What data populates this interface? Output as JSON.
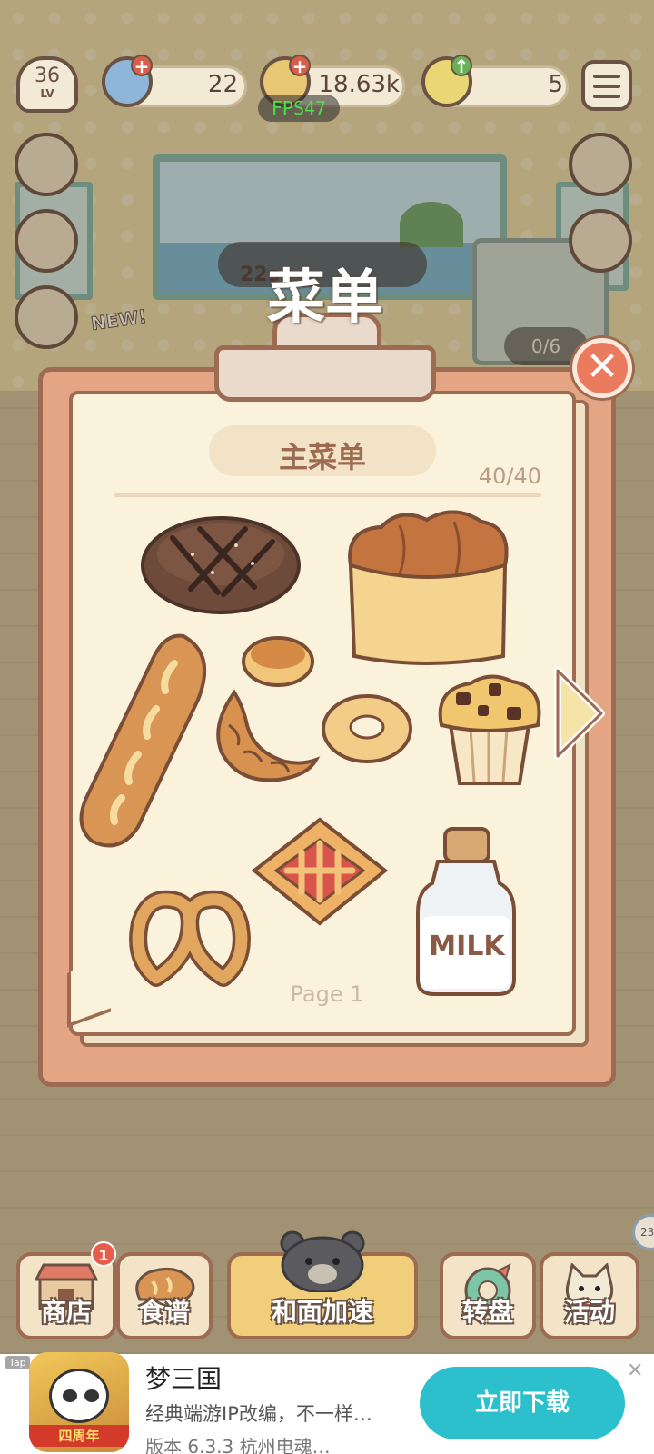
{
  "hud": {
    "level": "36",
    "level_label": "LV",
    "gems": "22",
    "coins": "18.63k",
    "stars": "5",
    "fps": "FPS47"
  },
  "scene": {
    "new_badge": "NEW!",
    "timer": "22s",
    "fridge_counter": "0/6"
  },
  "dialog": {
    "title": "菜单",
    "subtitle": "主菜单",
    "count": "40/40",
    "page": "Page 1",
    "milk_label": "MILK",
    "close_glyph": "✕",
    "items": [
      {
        "icon": "boule-bread-icon"
      },
      {
        "icon": "loaf-bread-icon"
      },
      {
        "icon": "baguette-icon"
      },
      {
        "icon": "bun-icon"
      },
      {
        "icon": "croissant-icon"
      },
      {
        "icon": "bagel-icon"
      },
      {
        "icon": "muffin-icon"
      },
      {
        "icon": "pie-pastry-icon"
      },
      {
        "icon": "pretzel-icon"
      },
      {
        "icon": "milk-bottle-icon"
      }
    ]
  },
  "nav": {
    "shop": "商店",
    "shop_badge": "1",
    "recipes": "食谱",
    "knead_speedup": "和面加速",
    "wheel": "转盘",
    "events": "活动"
  },
  "floating_coin": "23",
  "ad": {
    "tag": "Tap",
    "title": "梦三国",
    "description": "经典端游IP改编，不一样…",
    "version": "版本 6.3.3  杭州电魂…",
    "cta": "立即下载",
    "close_glyph": "✕",
    "icon_ribbon": "四周年"
  },
  "colors": {
    "clipboard": "#e3a583",
    "paper": "#fbf2dc",
    "outline": "#9d6a52",
    "close": "#ea7b5e",
    "cta": "#2cc0cc"
  }
}
